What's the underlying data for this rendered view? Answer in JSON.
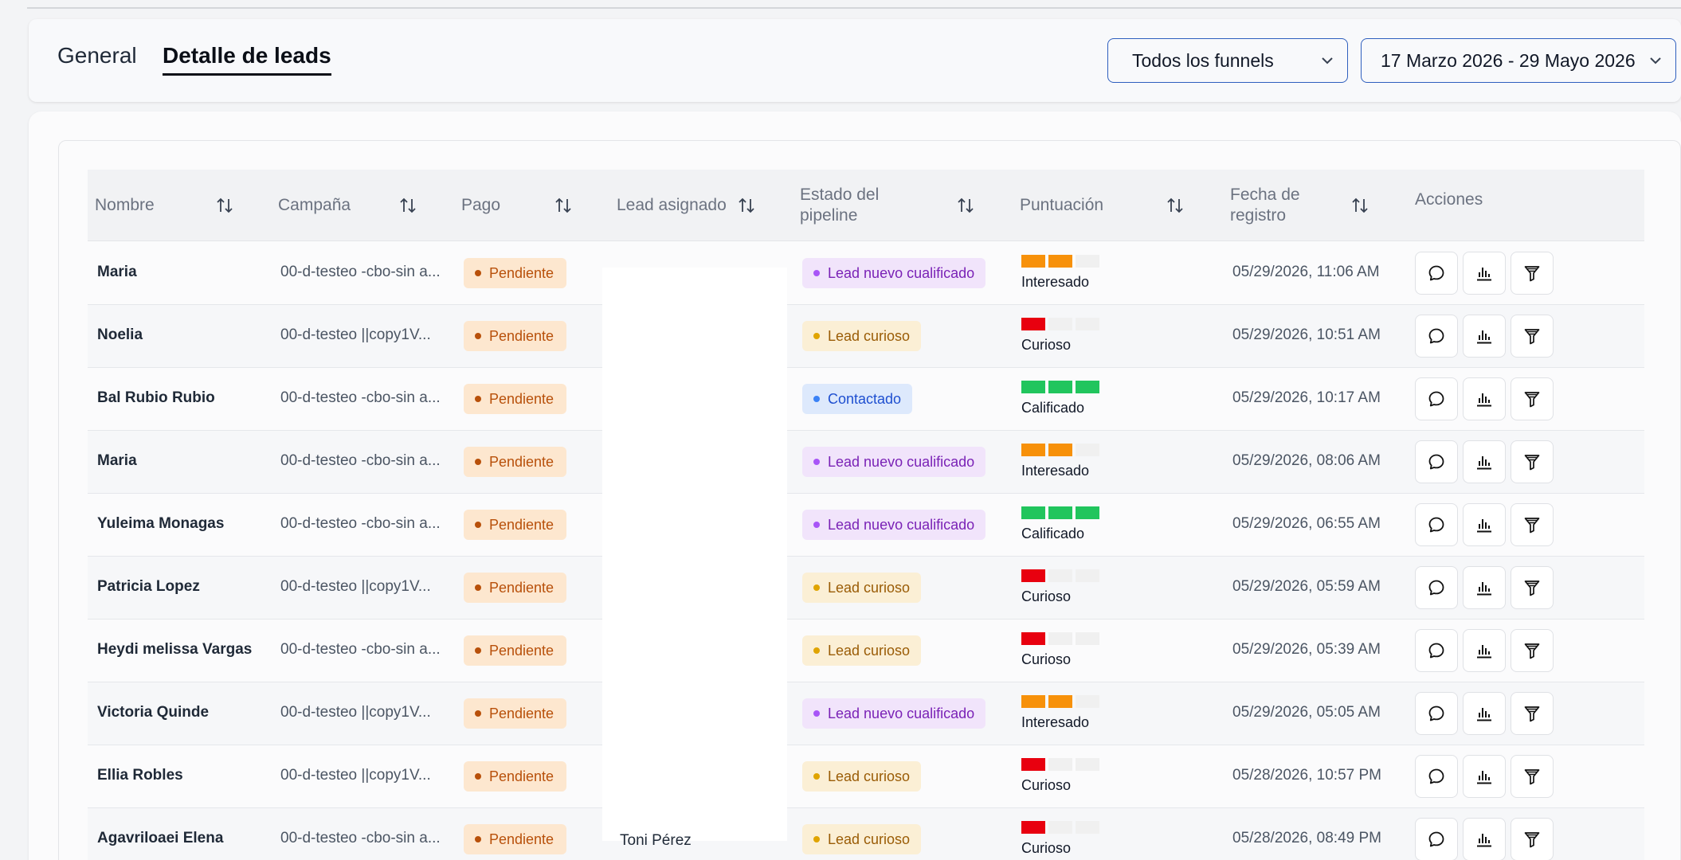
{
  "tabs": {
    "general": "General",
    "detail": "Detalle de leads"
  },
  "filters": {
    "funnel": "Todos los funnels",
    "date_range": "17 Marzo 2026 - 29 Mayo 2026"
  },
  "table": {
    "columns": {
      "name": "Nombre",
      "campaign": "Campaña",
      "payment": "Pago",
      "assigned_line1": "Lead asignado",
      "status_line1": "Estado del",
      "status_line2": "pipeline",
      "score": "Puntuación",
      "date_line1": "Fecha de",
      "date_line2": "registro",
      "actions": "Acciones"
    },
    "rows": [
      {
        "name": "Maria",
        "campaign": "00-d-testeo -cbo-sin a...",
        "payment": "Pendiente",
        "status": "Lead nuevo cualificado",
        "score_level": 2,
        "score_label": "Interesado",
        "date": "05/29/2026, 11:06 AM"
      },
      {
        "name": "Noelia",
        "campaign": "00-d-testeo ||copy1V...",
        "payment": "Pendiente",
        "status": "Lead curioso",
        "score_level": 1,
        "score_label": "Curioso",
        "date": "05/29/2026, 10:51 AM"
      },
      {
        "name": "Bal Rubio Rubio",
        "campaign": "00-d-testeo -cbo-sin a...",
        "payment": "Pendiente",
        "status": "Contactado",
        "score_level": 3,
        "score_label": "Calificado",
        "date": "05/29/2026, 10:17 AM"
      },
      {
        "name": "Maria",
        "campaign": "00-d-testeo -cbo-sin a...",
        "payment": "Pendiente",
        "status": "Lead nuevo cualificado",
        "score_level": 2,
        "score_label": "Interesado",
        "date": "05/29/2026, 08:06 AM"
      },
      {
        "name": "Yuleima Monagas",
        "campaign": "00-d-testeo -cbo-sin a...",
        "payment": "Pendiente",
        "status": "Lead nuevo cualificado",
        "score_level": 3,
        "score_label": "Calificado",
        "date": "05/29/2026, 06:55 AM"
      },
      {
        "name": "Patricia Lopez",
        "campaign": "00-d-testeo ||copy1V...",
        "payment": "Pendiente",
        "status": "Lead curioso",
        "score_level": 1,
        "score_label": "Curioso",
        "date": "05/29/2026, 05:59 AM"
      },
      {
        "name": "Heydi melissa Vargas",
        "campaign": "00-d-testeo -cbo-sin a...",
        "payment": "Pendiente",
        "status": "Lead curioso",
        "score_level": 1,
        "score_label": "Curioso",
        "date": "05/29/2026, 05:39 AM"
      },
      {
        "name": "Victoria Quinde",
        "campaign": "00-d-testeo ||copy1V...",
        "payment": "Pendiente",
        "status": "Lead nuevo cualificado",
        "score_level": 2,
        "score_label": "Interesado",
        "date": "05/29/2026, 05:05 AM"
      },
      {
        "name": "Ellia Robles",
        "campaign": "00-d-testeo ||copy1V...",
        "payment": "Pendiente",
        "status": "Lead curioso",
        "score_level": 1,
        "score_label": "Curioso",
        "date": "05/28/2026, 10:57 PM"
      },
      {
        "name": "Agavriloaei Elena",
        "campaign": "00-d-testeo -cbo-sin a...",
        "payment": "Pendiente",
        "status": "Lead curioso",
        "score_level": 1,
        "score_label": "Curioso",
        "date": "05/28/2026, 08:49 PM"
      }
    ],
    "assigned_visible_last": "Toni Pérez"
  },
  "colors": {
    "score_red": "#e8000f",
    "score_orange": "#f7910a",
    "score_green": "#21c55d",
    "score_empty": "#f0f0f0"
  },
  "icons": {
    "action1": "chat-bubble-icon",
    "action2": "bar-chart-icon",
    "action3": "funnel-filter-icon",
    "sort": "sort-arrows-icon",
    "dropdown": "chevron-down-icon"
  }
}
